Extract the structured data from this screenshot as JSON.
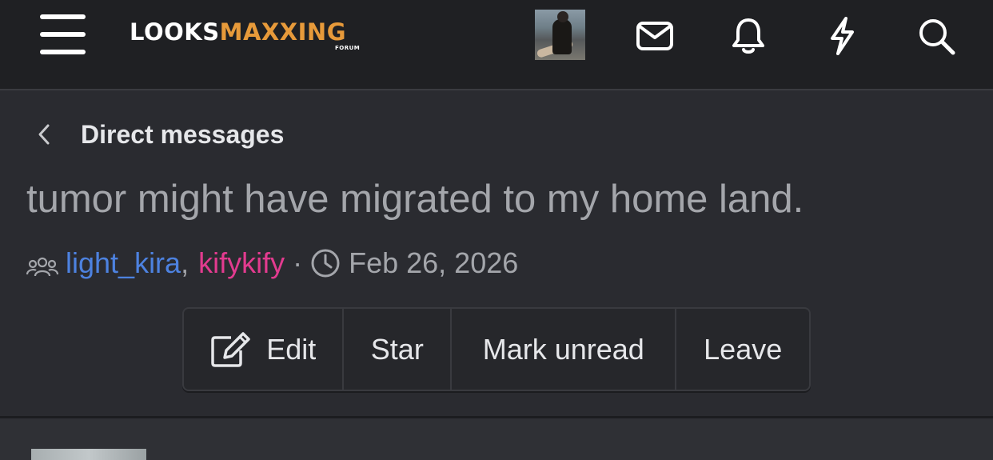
{
  "header": {
    "logo_part1": "LOOKS",
    "logo_part2": "MAXXING",
    "logo_sub": "FORUM",
    "icons": [
      "menu-icon",
      "avatar",
      "envelope-icon",
      "bell-icon",
      "lightning-icon",
      "search-icon"
    ],
    "accent_color": "#e79a3a"
  },
  "breadcrumb": {
    "label": "Direct messages"
  },
  "conversation": {
    "title": "tumor might have migrated to my home land.",
    "participants": [
      {
        "name": "light_kira",
        "color": "#4d82e0"
      },
      {
        "name": "kifykify",
        "color": "#e23b8f"
      }
    ],
    "separator": ",",
    "dot": "·",
    "date": "Feb 26, 2026"
  },
  "actions": {
    "edit": "Edit",
    "star": "Star",
    "mark_unread": "Mark unread",
    "leave": "Leave"
  }
}
